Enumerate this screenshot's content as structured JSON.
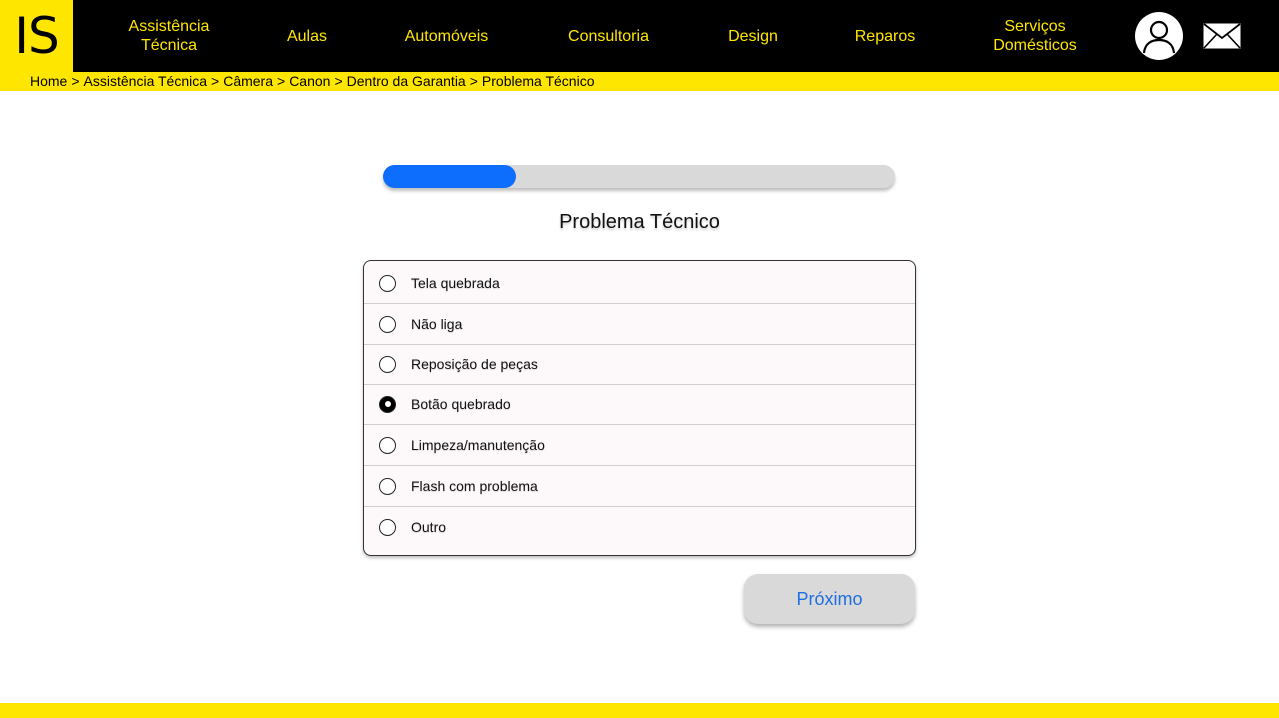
{
  "brand": {
    "logo_text": "IS",
    "accent_color": "#ffe600",
    "header_bg": "#000000"
  },
  "nav": {
    "items": [
      {
        "line1": "Assistência",
        "line2": "Técnica"
      },
      {
        "line1": "Aulas",
        "line2": ""
      },
      {
        "line1": "Automóveis",
        "line2": ""
      },
      {
        "line1": "Consultoria",
        "line2": ""
      },
      {
        "line1": "Design",
        "line2": ""
      },
      {
        "line1": "Reparos",
        "line2": ""
      },
      {
        "line1": "Serviços",
        "line2": "Domésticos"
      }
    ],
    "user_icon": "user-icon",
    "mail_icon": "mail-icon"
  },
  "breadcrumb": {
    "items": [
      "Home",
      "Assistência Técnica",
      "Câmera",
      "Canon",
      "Dentro da Garantia",
      "Problema Técnico"
    ],
    "separator": ">"
  },
  "progress": {
    "value_percent": 26,
    "fill_color": "#0d6efd"
  },
  "step": {
    "title": "Problema Técnico"
  },
  "options": {
    "items": [
      {
        "label": "Tela quebrada",
        "selected": false
      },
      {
        "label": "Não liga",
        "selected": false
      },
      {
        "label": "Reposição de peças",
        "selected": false
      },
      {
        "label": "Botão quebrado",
        "selected": true
      },
      {
        "label": "Limpeza/manutenção",
        "selected": false
      },
      {
        "label": "Flash com problema",
        "selected": false
      },
      {
        "label": "Outro",
        "selected": false
      }
    ]
  },
  "actions": {
    "next_label": "Próximo"
  }
}
